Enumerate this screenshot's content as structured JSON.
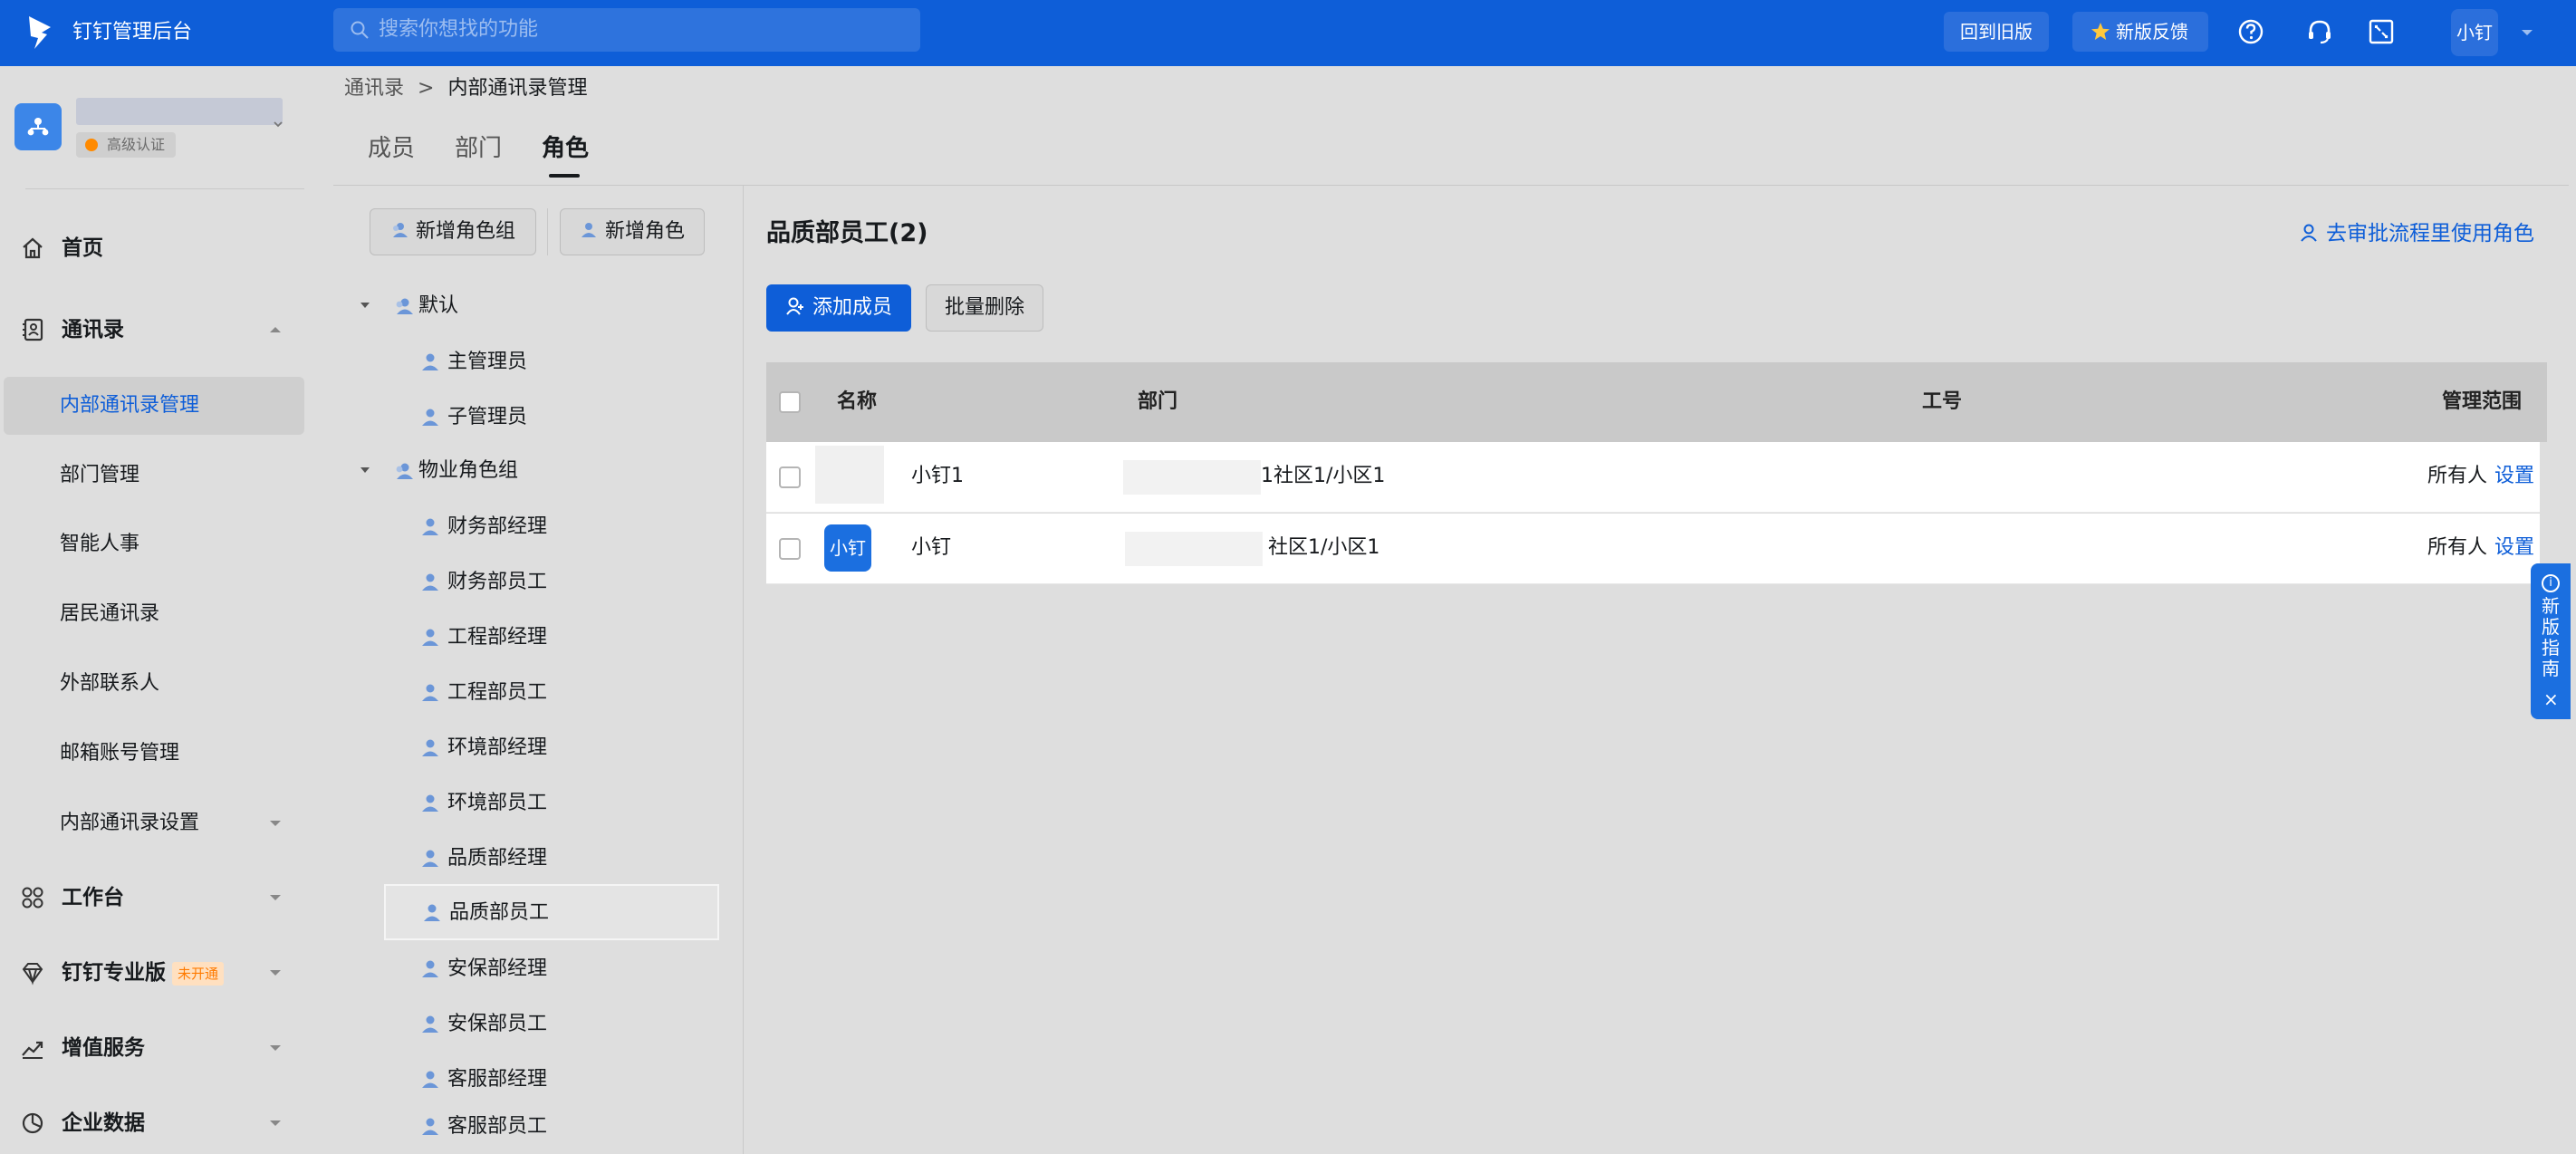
{
  "header": {
    "app_title": "钉钉管理后台",
    "search_placeholder": "搜索你想找的功能",
    "back_old_label": "回到旧版",
    "feedback_label": "新版反馈",
    "user_label": "小钉",
    "icons": [
      "help-icon",
      "headset-icon",
      "fullscreen-icon",
      "chevron-down-icon"
    ]
  },
  "org": {
    "cert_label": "高级认证"
  },
  "sidebar": {
    "home": "首页",
    "contacts": "通讯录",
    "contacts_sub": [
      "内部通讯录管理",
      "部门管理",
      "智能人事",
      "居民通讯录",
      "外部联系人",
      "邮箱账号管理",
      "内部通讯录设置"
    ],
    "workbench": "工作台",
    "pro": "钉钉专业版",
    "pro_badge": "未开通",
    "vas": "增值服务",
    "data": "企业数据"
  },
  "breadcrumb": {
    "root": "通讯录",
    "sep": ">",
    "current": "内部通讯录管理"
  },
  "tabs": [
    "成员",
    "部门",
    "角色"
  ],
  "actions": {
    "add_group": "新增角色组",
    "add_role": "新增角色"
  },
  "tree": {
    "groups": [
      {
        "label": "默认",
        "items": [
          "主管理员",
          "子管理员"
        ]
      },
      {
        "label": "物业角色组",
        "items": [
          "财务部经理",
          "财务部员工",
          "工程部经理",
          "工程部员工",
          "环境部经理",
          "环境部员工",
          "品质部经理",
          "品质部员工",
          "安保部经理",
          "安保部员工",
          "客服部经理",
          "客服部员工"
        ]
      }
    ],
    "selected": "品质部员工"
  },
  "panel": {
    "title": "品质部员工(2)",
    "use_link": "去审批流程里使用角色",
    "add_member": "添加成员",
    "batch_delete": "批量删除",
    "columns": [
      "名称",
      "部门",
      "工号",
      "管理范围"
    ],
    "rows": [
      {
        "name": "小钉1",
        "dept": "1社区1/小区1",
        "job_no": "",
        "scope": "所有人",
        "action": "设置",
        "avatar": ""
      },
      {
        "name": "小钉",
        "dept": "社区1/小区1",
        "job_no": "",
        "scope": "所有人",
        "action": "设置",
        "avatar": "小钉"
      }
    ]
  },
  "guide": {
    "text": "新版指南",
    "info": "i",
    "close": "×"
  },
  "colors": {
    "brand": "#0e5ed8",
    "badge": "#ff7a00"
  }
}
